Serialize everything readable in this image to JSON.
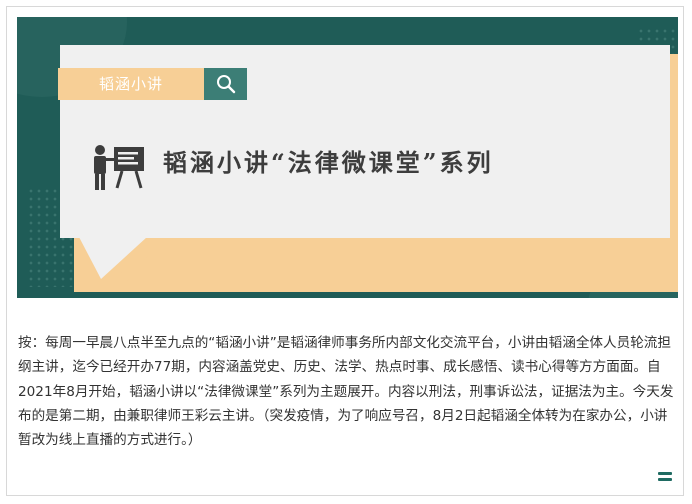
{
  "banner": {
    "search_label": "韬涵小讲",
    "title": "韬涵小讲“法律微课堂”系列",
    "colors": {
      "background": "#1f5c57",
      "accent": "#f7cf96",
      "card": "#f0f0f0",
      "search_button": "#3c7e76"
    },
    "icons": {
      "search": "search-icon",
      "lecture": "presenter-board-icon"
    }
  },
  "article": {
    "body": "按：每周一早晨八点半至九点的“韬涵小讲”是韬涵律师事务所内部文化交流平台，小讲由韬涵全体人员轮流担纲主讲，迄今已经开办77期，内容涵盖党史、历史、法学、热点时事、成长感悟、读书心得等方方面面。自2021年8月开始，韬涵小讲以“法律微课堂”系列为主题展开。内容以刑法，刑事诉讼法，证据法为主。今天发布的是第二期，由兼职律师王彩云主讲。（突发疫情，为了响应号召，8月2日起韬涵全体转为在家办公，小讲暂改为线上直播的方式进行。）"
  },
  "footer": {
    "menu_icon": "hamburger-menu-icon"
  }
}
